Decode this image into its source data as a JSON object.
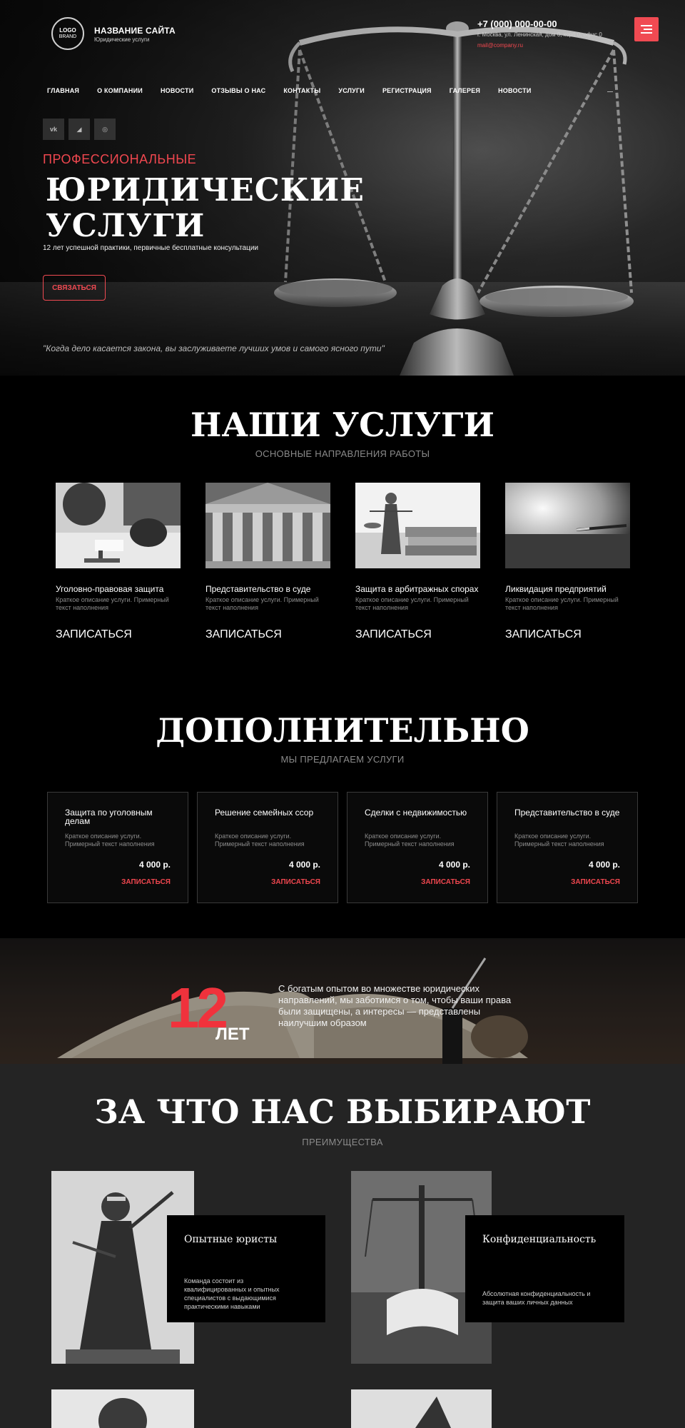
{
  "header": {
    "logo_line1": "LOGO",
    "logo_line2": "BRAND",
    "site_name": "НАЗВАНИЕ САЙТА",
    "site_subtitle": "Юридические услуги",
    "phone": "+7 (000) 000-00-00",
    "address": "г. Москва, ул. Ленинская, дом 0, корп 0, офис 0",
    "email": "mail@company.ru",
    "menu_icon": "hamburger-icon",
    "accent_color": "#f04a52"
  },
  "nav": {
    "items": [
      {
        "label": "ГЛАВНАЯ"
      },
      {
        "label": "О КОМПАНИИ"
      },
      {
        "label": "НОВОСТИ"
      },
      {
        "label": "ОТЗЫВЫ О НАС"
      },
      {
        "label": "КОНТАКТЫ"
      },
      {
        "label": "УСЛУГИ"
      },
      {
        "label": "РЕГИСТРАЦИЯ"
      },
      {
        "label": "ГАЛЕРЕЯ"
      },
      {
        "label": "НОВОСТИ"
      }
    ]
  },
  "social": [
    {
      "icon": "vk-icon",
      "glyph": "vk"
    },
    {
      "icon": "telegram-icon",
      "glyph": "◢"
    },
    {
      "icon": "instagram-icon",
      "glyph": "◎"
    }
  ],
  "hero": {
    "kicker": "ПРОФЕССИОНАЛЬНЫЕ",
    "headline_line1": "ЮРИДИЧЕСКИЕ",
    "headline_line2": "УСЛУГИ",
    "tagline": "12 лет успешной практики, первичные бесплатные консультации",
    "button": "СВЯЗАТЬСЯ",
    "quote": "\"Когда дело касается закона, вы заслуживаете лучших умов и самого ясного пути\""
  },
  "services": {
    "title": "НАШИ УСЛУГИ",
    "subtitle": "ОСНОВНЫЕ НАПРАВЛЕНИЯ РАБОТЫ",
    "items": [
      {
        "title": "Уголовно-правовая защита",
        "desc": "Краткое описание услуги. Примерный текст наполнения",
        "cta": "ЗАПИСАТЬСЯ"
      },
      {
        "title": "Представительство в суде",
        "desc": "Краткое описание услуги. Примерный текст наполнения",
        "cta": "ЗАПИСАТЬСЯ"
      },
      {
        "title": "Защита в арбитражных спорах",
        "desc": "Краткое описание услуги. Примерный текст наполнения",
        "cta": "ЗАПИСАТЬСЯ"
      },
      {
        "title": "Ликвидация предприятий",
        "desc": "Краткое описание услуги. Примерный текст наполнения",
        "cta": "ЗАПИСАТЬСЯ"
      }
    ]
  },
  "extra": {
    "title": "ДОПОЛНИТЕЛЬНО",
    "subtitle": "МЫ ПРЕДЛАГАЕМ УСЛУГИ",
    "items": [
      {
        "title": "Защита по уголовным делам",
        "desc": "Краткое описание услуги. Примерный текст наполнения",
        "price": "4 000 р.",
        "cta": "ЗАПИСАТЬСЯ"
      },
      {
        "title": "Решение семейных ссор",
        "desc": "Краткое описание услуги. Примерный текст наполнения",
        "price": "4 000 р.",
        "cta": "ЗАПИСАТЬСЯ"
      },
      {
        "title": "Сделки с недвижимостью",
        "desc": "Краткое описание услуги. Примерный текст наполнения",
        "price": "4 000 р.",
        "cta": "ЗАПИСАТЬСЯ"
      },
      {
        "title": "Представительство в суде",
        "desc": "Краткое описание услуги. Примерный текст наполнения",
        "price": "4 000 р.",
        "cta": "ЗАПИСАТЬСЯ"
      }
    ]
  },
  "banner": {
    "number": "12",
    "unit": "ЛЕТ",
    "text": "С богатым опытом во множестве юридических направлений, мы заботимся о том, чтобы ваши права были защищены, а интересы — представлены наилучшим образом"
  },
  "why": {
    "title": "ЗА ЧТО НАС ВЫБИРАЮТ",
    "subtitle": "ПРЕИМУЩЕСТВА",
    "items": [
      {
        "title": "Опытные юристы",
        "desc": "Команда состоит из квалифицированных и опытных специалистов с выдающимися практическими навыками"
      },
      {
        "title": "Конфиденциальность",
        "desc": "Абсолютная конфиденциальность и защита ваших личных данных"
      }
    ]
  }
}
